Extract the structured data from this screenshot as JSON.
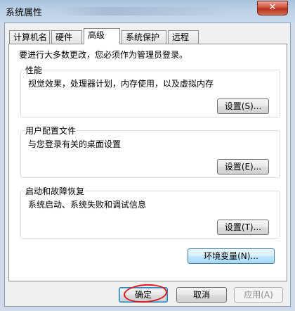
{
  "window": {
    "title": "系统属性",
    "close_symbol": "✕"
  },
  "tabs": [
    {
      "label": "计算机名"
    },
    {
      "label": "硬件"
    },
    {
      "label": "高级"
    },
    {
      "label": "系统保护"
    },
    {
      "label": "远程"
    }
  ],
  "notice": "要进行大多数更改，您必须作为管理员登录。",
  "groups": {
    "performance": {
      "title": "性能",
      "description": "视觉效果，处理器计划，内存使用，以及虚拟内存",
      "button_label": "设置(S)..."
    },
    "user_profiles": {
      "title": "用户配置文件",
      "description": "与您登录有关的桌面设置",
      "button_label": "设置(E)..."
    },
    "startup_recovery": {
      "title": "启动和故障恢复",
      "description": "系统启动、系统失败和调试信息",
      "button_label": "设置(T)..."
    }
  },
  "env_button_label": "环境变量(N)...",
  "footer": {
    "ok_label": "确定",
    "cancel_label": "取消",
    "apply_label": "应用(A)"
  },
  "annotation_color": "#e0181e"
}
